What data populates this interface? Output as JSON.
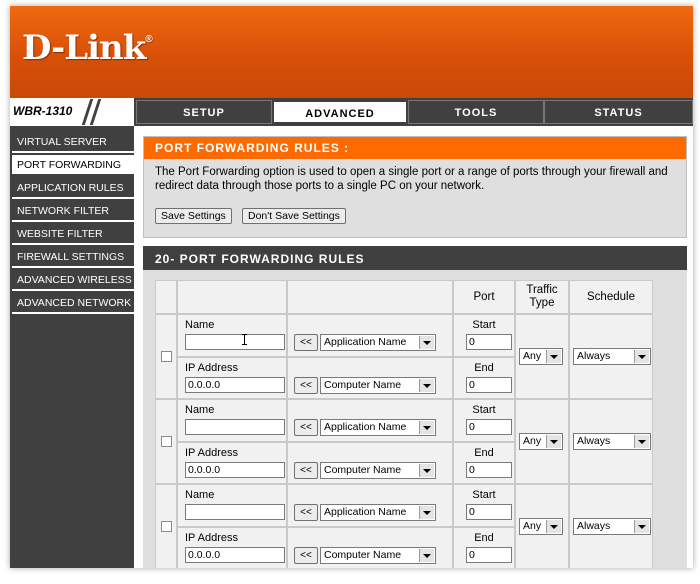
{
  "brand": {
    "logo": "D-Link",
    "mark": "®"
  },
  "model": "WBR-1310",
  "tabs": [
    "SETUP",
    "ADVANCED",
    "TOOLS",
    "STATUS"
  ],
  "active_tab": "ADVANCED",
  "sidebar": [
    "VIRTUAL SERVER",
    "PORT FORWARDING",
    "APPLICATION RULES",
    "NETWORK FILTER",
    "WEBSITE FILTER",
    "FIREWALL SETTINGS",
    "ADVANCED WIRELESS",
    "ADVANCED NETWORK"
  ],
  "active_sidebar": "PORT FORWARDING",
  "intro": {
    "title": "PORT FORWARDING RULES :",
    "description": "The Port Forwarding option is used to open a single port or a range of ports through your firewall and redirect data through those ports to a single PC on your network.",
    "save_label": "Save Settings",
    "dont_save_label": "Don't Save Settings"
  },
  "rules": {
    "title": "20- PORT FORWARDING RULES",
    "columns": {
      "port": "Port",
      "traffic_type": "Traffic Type",
      "schedule": "Schedule"
    },
    "name_label": "Name",
    "ip_label": "IP Address",
    "start_label": "Start",
    "end_label": "End",
    "arrow_label": "<<",
    "rows": [
      {
        "name": "",
        "ip": "0.0.0.0",
        "app_select": "Application Name",
        "computer_select": "Computer Name",
        "start": "0",
        "end": "0",
        "traffic": "Any",
        "schedule": "Always"
      },
      {
        "name": "",
        "ip": "0.0.0.0",
        "app_select": "Application Name",
        "computer_select": "Computer Name",
        "start": "0",
        "end": "0",
        "traffic": "Any",
        "schedule": "Always"
      },
      {
        "name": "",
        "ip": "0.0.0.0",
        "app_select": "Application Name",
        "computer_select": "Computer Name",
        "start": "0",
        "end": "0",
        "traffic": "Any",
        "schedule": "Always"
      }
    ]
  }
}
